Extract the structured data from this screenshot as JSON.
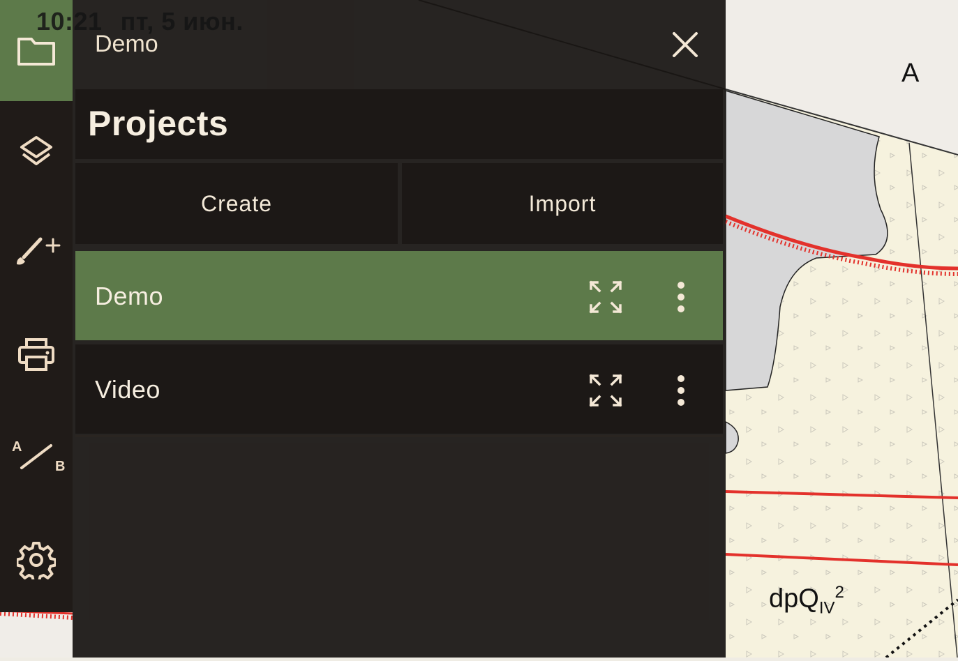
{
  "status_bar": {
    "time": "10:21",
    "date": "пт, 5 июн."
  },
  "toolbar": {
    "items": [
      {
        "name": "projects",
        "icon": "folder-icon",
        "active": true
      },
      {
        "name": "layers",
        "icon": "layers-icon",
        "active": false
      },
      {
        "name": "draw",
        "icon": "brush-plus-icon",
        "active": false
      },
      {
        "name": "print",
        "icon": "printer-icon",
        "active": false
      },
      {
        "name": "measure",
        "icon": "ruler-ab-icon",
        "active": false
      },
      {
        "name": "settings",
        "icon": "gear-icon",
        "active": false
      }
    ],
    "measure_labels": {
      "a": "A",
      "b": "B"
    }
  },
  "panel": {
    "header_title": "Demo",
    "heading": "Projects",
    "create_label": "Create",
    "import_label": "Import",
    "projects": [
      {
        "name": "Demo",
        "selected": true
      },
      {
        "name": "Video",
        "selected": false
      }
    ]
  },
  "map": {
    "label_a": "A",
    "geo_label_main": "dpQ",
    "geo_label_sub": "IV",
    "geo_label_sup": "2"
  },
  "colors": {
    "accent": "#5d7a4a",
    "panel_bg": "#1c1816",
    "toolbar_bg": "#201b18",
    "icon": "#efdcc4",
    "map_line": "#e3312b"
  }
}
